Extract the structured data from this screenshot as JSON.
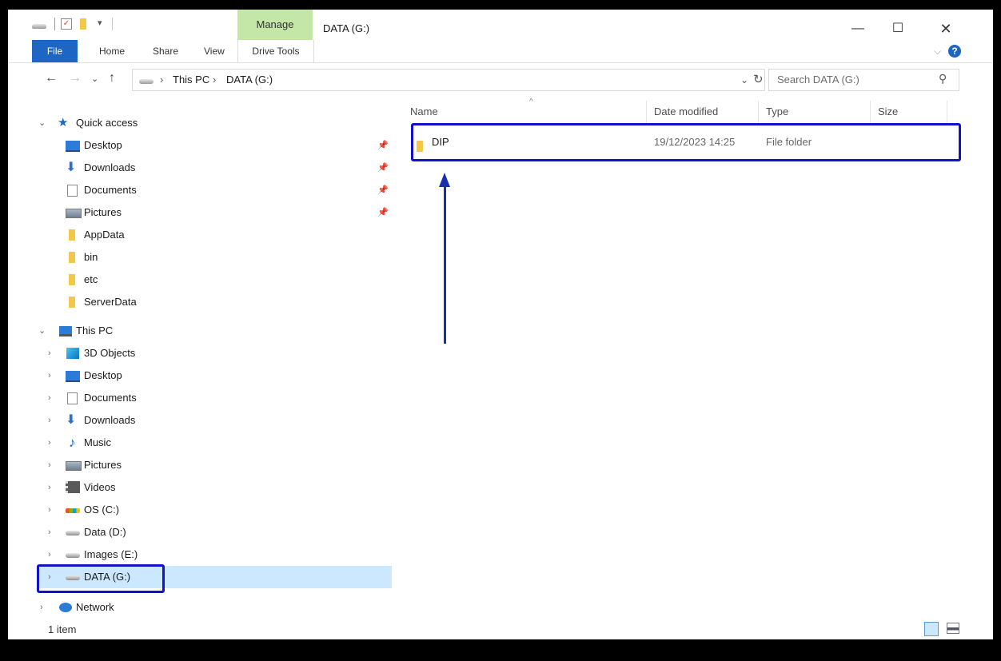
{
  "window": {
    "title": "DATA (G:)",
    "contextual_tab": "Manage"
  },
  "caption_buttons": {
    "minimize": "—",
    "maximize": "☐",
    "close": "✕"
  },
  "ribbon": {
    "tabs": [
      "File",
      "Home",
      "Share",
      "View",
      "Drive Tools"
    ],
    "expand_glyph": "⌵",
    "help_glyph": "?"
  },
  "address": {
    "separator": "›",
    "breadcrumbs": [
      "This PC",
      "DATA (G:)"
    ],
    "search_placeholder": "Search DATA (G:)"
  },
  "nav_glyphs": {
    "back": "←",
    "forward": "→",
    "recent": "⌄",
    "up": "↑",
    "refresh": "↻",
    "dropdown": "⌄",
    "search": "⚲"
  },
  "navpane": {
    "quick_access": {
      "label": "Quick access",
      "items": [
        "Desktop",
        "Downloads",
        "Documents",
        "Pictures",
        "AppData",
        "bin",
        "etc",
        "ServerData"
      ]
    },
    "this_pc": {
      "label": "This PC",
      "items": [
        "3D Objects",
        "Desktop",
        "Documents",
        "Downloads",
        "Music",
        "Pictures",
        "Videos",
        "OS (C:)",
        "Data (D:)",
        "Images (E:)",
        "DATA (G:)"
      ]
    },
    "network": {
      "label": "Network"
    }
  },
  "content": {
    "columns": [
      "Name",
      "Date modified",
      "Type",
      "Size"
    ],
    "rows": [
      {
        "name": "DIP",
        "date_modified": "19/12/2023 14:25",
        "type": "File folder",
        "size": ""
      }
    ]
  },
  "status": {
    "item_count": "1 item"
  },
  "colors": {
    "accent": "#1e66c3",
    "manage_tab": "#c4e7a7",
    "selection": "#cce8ff",
    "annotation": "#1212c8"
  }
}
